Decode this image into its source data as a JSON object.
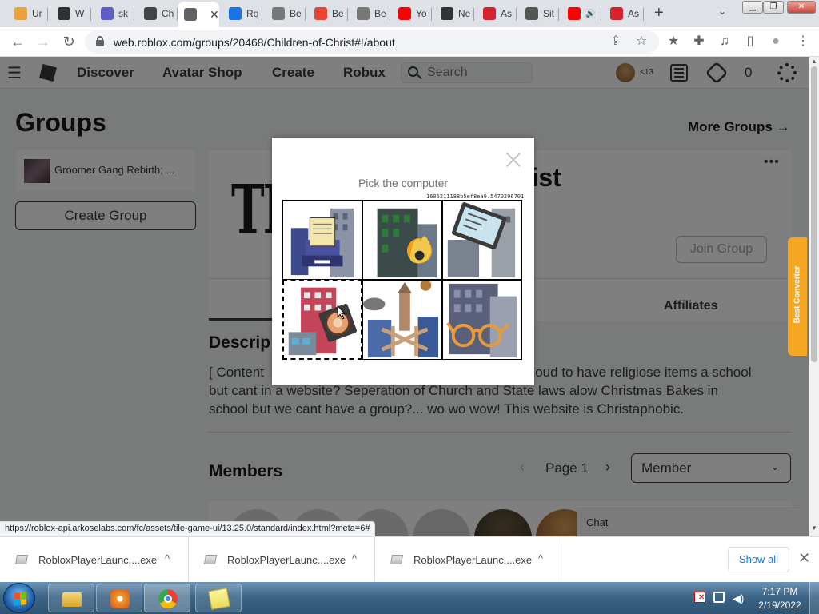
{
  "browser": {
    "tabs": [
      {
        "label": "Ur",
        "color": "#e8a33d"
      },
      {
        "label": "W",
        "color": "#2f2f2f"
      },
      {
        "label": "sk",
        "color": "#5b5fc7"
      },
      {
        "label": "Ch",
        "color": "#444444"
      },
      {
        "label": "",
        "color": "#5f6368",
        "active": true
      },
      {
        "label": "Ro",
        "color": "#1a73e8"
      },
      {
        "label": "Be",
        "color": "#777777"
      },
      {
        "label": "Be",
        "color": "#e94335"
      },
      {
        "label": "Be",
        "color": "#777777"
      },
      {
        "label": "Yo",
        "color": "#ff0000"
      },
      {
        "label": "Ne",
        "color": "#333333"
      },
      {
        "label": "As",
        "color": "#d6212f"
      },
      {
        "label": "Sit",
        "color": "#555555"
      },
      {
        "label": "",
        "color": "#ff0000",
        "audio": true
      },
      {
        "label": "As",
        "color": "#d6212f"
      }
    ],
    "active_tab_close": "✕",
    "new_tab": "+",
    "tab_search": "⌄",
    "window_controls": {
      "minimize": "▁",
      "maximize": "❐",
      "close": "✕"
    },
    "url": "web.roblox.com/groups/20468/Children-of-Christ#!/about",
    "back": "←",
    "forward": "→",
    "reload": "↻",
    "toolbar_icons": {
      "share": "⇪",
      "bookmark": "☆",
      "extension_star": "★",
      "extensions": "✚",
      "media": "♫",
      "sidepanel": "▯",
      "profile": "●",
      "menu": "⋮"
    }
  },
  "roblox": {
    "nav": {
      "menu": "☰",
      "discover": "Discover",
      "avatar_shop": "Avatar Shop",
      "create": "Create",
      "robux": "Robux",
      "search_placeholder": "Search",
      "age_label": "<13",
      "robux_count": "0"
    },
    "page_title": "Groups",
    "more_groups": "More Groups →",
    "my_group": "Groomer Gang Rebirth; ...",
    "create_group": "Create Group",
    "group": {
      "name_visible": "rist",
      "more": "•••",
      "join": "Join Group",
      "emblem_text": "TRU"
    },
    "tabs": {
      "affiliates": "Affiliates"
    },
    "description": {
      "heading": "Descrip",
      "line1_left": "[ Content",
      "line1_right": "aloud to have religiose items a school",
      "line2": "but cant in a website? Seperation of Church and State laws alow Christmas Bakes in",
      "line3": "school but we cant have a group?... wo wo wow! This website is Christaphobic."
    },
    "members": {
      "heading": "Members",
      "prev": "‹",
      "page_label": "Page 1",
      "next": "›",
      "role_selected": "Member",
      "role_chevron": "⌄"
    },
    "chat": "Chat",
    "extension_tab": "Best Converter"
  },
  "captcha": {
    "prompt": "Pick the computer",
    "session_code": "1606211188b5ef8ea9.5470296701",
    "tiles": [
      {
        "depicts": "printer-with-buildings"
      },
      {
        "depicts": "fire-with-building"
      },
      {
        "depicts": "computer-monitor-with-skyscrapers"
      },
      {
        "depicts": "coin-building-selected",
        "selected": true
      },
      {
        "depicts": "church-tower-with-buildings"
      },
      {
        "depicts": "glasses-with-skyscraper"
      }
    ]
  },
  "status_url": "https://roblox-api.arkoselabs.com/fc/assets/tile-game-ui/13.25.0/standard/index.html?meta=6#",
  "downloads": {
    "items": [
      {
        "name": "RobloxPlayerLaunc....exe"
      },
      {
        "name": "RobloxPlayerLaunc....exe"
      },
      {
        "name": "RobloxPlayerLaunc....exe"
      }
    ],
    "caret": "^",
    "show_all": "Show all",
    "close": "✕"
  },
  "taskbar": {
    "time": "7:17 PM",
    "date": "2/19/2022"
  },
  "colors": {
    "accent_blue": "#1a73e8",
    "extension_orange": "#f5a623",
    "overlay": "rgba(0,0,0,0.5)"
  }
}
